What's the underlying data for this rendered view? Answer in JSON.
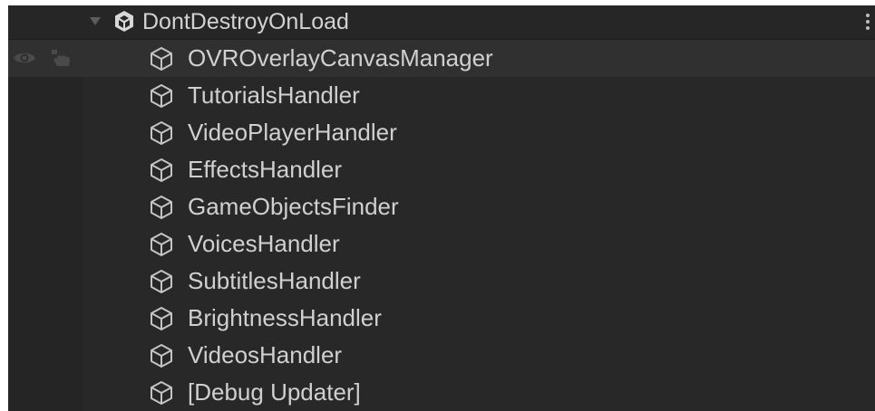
{
  "hierarchy": {
    "scene": {
      "label": "DontDestroyOnLoad",
      "icon": "unity-scene-icon"
    },
    "objects": [
      {
        "label": "OVROverlayCanvasManager",
        "icon": "gameobject-cube-icon",
        "hovered": true
      },
      {
        "label": "TutorialsHandler",
        "icon": "gameobject-cube-icon"
      },
      {
        "label": "VideoPlayerHandler",
        "icon": "gameobject-cube-icon"
      },
      {
        "label": "EffectsHandler",
        "icon": "gameobject-cube-icon"
      },
      {
        "label": "GameObjectsFinder",
        "icon": "gameobject-cube-icon"
      },
      {
        "label": "VoicesHandler",
        "icon": "gameobject-cube-icon"
      },
      {
        "label": "SubtitlesHandler",
        "icon": "gameobject-cube-icon"
      },
      {
        "label": "BrightnessHandler",
        "icon": "gameobject-cube-icon"
      },
      {
        "label": "VideosHandler",
        "icon": "gameobject-cube-icon"
      },
      {
        "label": "[Debug Updater]",
        "icon": "gameobject-cube-icon"
      }
    ]
  },
  "colors": {
    "panel_bg": "#282828",
    "hover_row": "#303030",
    "text": "#d0d0d0",
    "icon": "#c4c4c4"
  }
}
